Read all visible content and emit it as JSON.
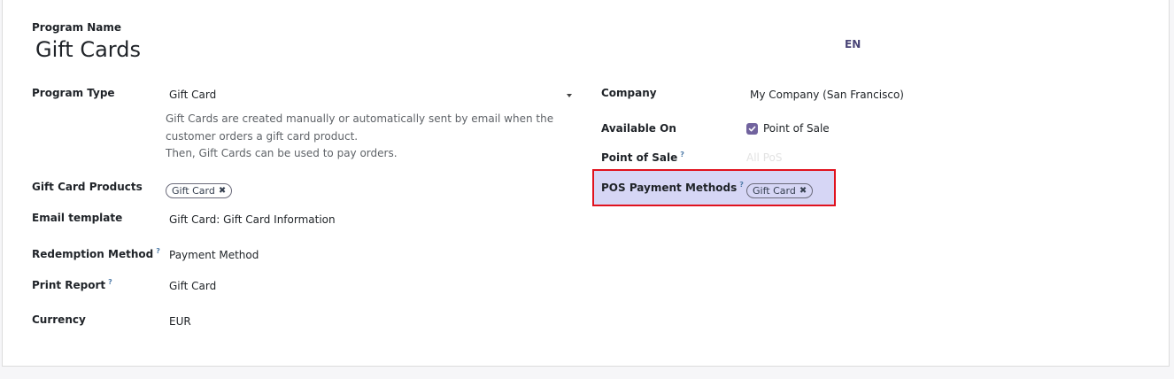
{
  "program_name": {
    "label": "Program Name",
    "value": "Gift Cards",
    "lang": "EN"
  },
  "left_fields": {
    "program_type": {
      "label": "Program Type",
      "value": "Gift Card"
    },
    "program_help": {
      "line1": "Gift Cards are created manually or automatically sent by email when the",
      "line2": "customer orders a gift card product.",
      "line3": "Then, Gift Cards can be used to pay orders."
    },
    "gift_card_products": {
      "label": "Gift Card Products",
      "tag": "Gift Card"
    },
    "email_template": {
      "label": "Email template",
      "value": "Gift Card: Gift Card Information"
    },
    "redemption_method": {
      "label": "Redemption Method",
      "help": "?",
      "value": "Payment Method"
    },
    "print_report": {
      "label": "Print Report",
      "help": "?",
      "value": "Gift Card"
    },
    "currency": {
      "label": "Currency",
      "value": "EUR"
    }
  },
  "right_fields": {
    "company": {
      "label": "Company",
      "value": "My Company (San Francisco)"
    },
    "available_on": {
      "label": "Available On",
      "option": "Point of Sale",
      "checked": true
    },
    "point_of_sale": {
      "label": "Point of Sale",
      "help": "?",
      "placeholder": "All PoS"
    },
    "pos_payment_methods": {
      "label": "POS Payment Methods",
      "help": "?",
      "tag": "Gift Card"
    }
  },
  "colors": {
    "highlight_fill": "#d6d6f5",
    "highlight_border": "#e0121e",
    "checkbox": "#71639e",
    "lang_badge": "#4a4577"
  }
}
